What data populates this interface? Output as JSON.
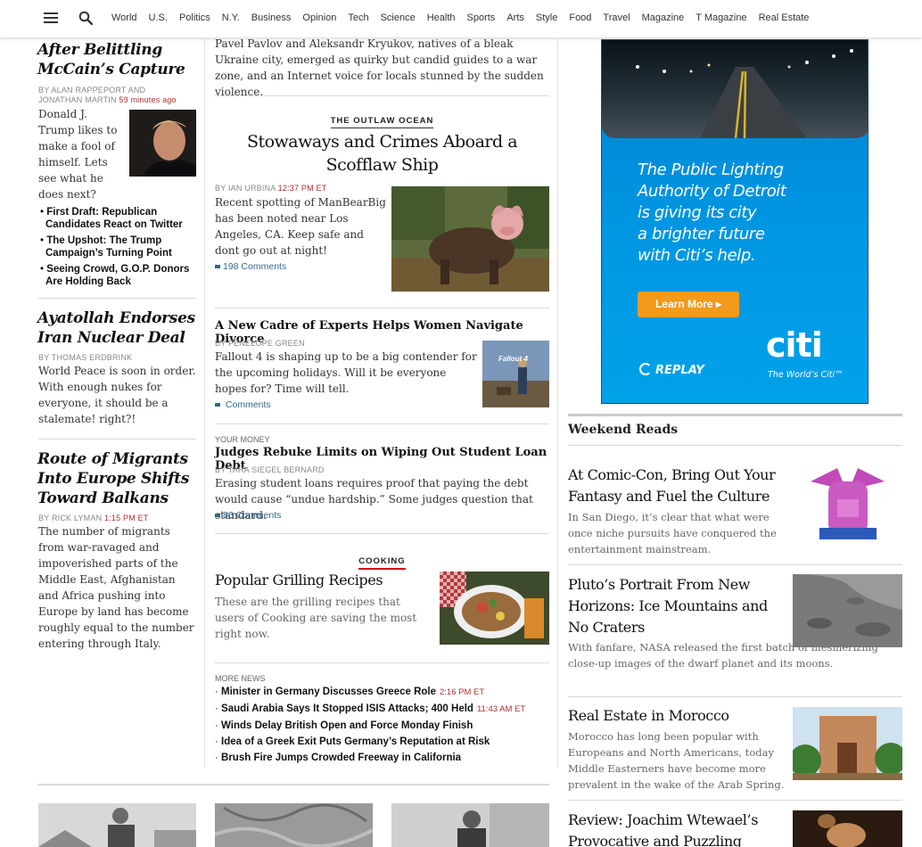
{
  "nav": {
    "items": [
      "World",
      "U.S.",
      "Politics",
      "N.Y.",
      "Business",
      "Opinion",
      "Tech",
      "Science",
      "Health",
      "Sports",
      "Arts",
      "Style",
      "Food",
      "Travel",
      "Magazine",
      "T Magazine",
      "Real Estate"
    ]
  },
  "left": {
    "story1": {
      "headline": "After Belittling McCain’s Capture",
      "byline_a": "By ALAN RAPPEPORT and",
      "byline_b": "JONATHAN MARTIN",
      "time": "59 minutes ago",
      "summary": "Donald J. Trump likes to make a fool of himself. Lets see what he does next?",
      "related": [
        "First Draft: Republican Candidates React on Twitter",
        "The Upshot: The Trump Campaign’s Turning Point",
        "Seeing Crowd, G.O.P. Donors Are Holding Back"
      ]
    },
    "story2": {
      "headline": "Ayatollah Endorses Iran Nuclear Deal",
      "byline": "By THOMAS ERDBRINK",
      "summary": "World Peace is soon in order. With enough nukes for everyone, it should be a stalemate! right?!"
    },
    "story3": {
      "headline": "Route of Migrants Into Europe Shifts Toward Balkans",
      "byline": "By RICK LYMAN",
      "time": "1:15 PM ET",
      "summary": "The number of migrants from war-ravaged and impoverished parts of the Middle East, Afghanistan and Africa pushing into Europe by land has become roughly equal to the number entering through Italy."
    }
  },
  "middle": {
    "top_summary": "Pavel Pavlov and Aleksandr Kryukov, natives of a bleak Ukraine city, emerged as quirky but candid guides to a war zone, and an Internet voice for locals stunned by the sudden violence.",
    "outlaw": {
      "kicker": "THE OUTLAW OCEAN",
      "headline": "Stowaways and Crimes Aboard a Scofflaw Ship",
      "byline": "By IAN URBINA",
      "time": "12:37 PM ET",
      "summary": "Recent spotting of ManBearBig has been noted near Los Angeles, CA. Keep safe and dont go out at night!",
      "comments": "198 Comments"
    },
    "divorce": {
      "headline": "A New Cadre of Experts Helps Women Navigate Divorce",
      "byline": "By PENELOPE GREEN",
      "summary": "Fallout 4 is shaping up to be a big contender for the upcoming holidays. Will it be everyone hopes for? Time will tell.",
      "comments": "Comments",
      "thumb_text": "Fallout 4"
    },
    "loans": {
      "section": "YOUR MONEY",
      "headline": "Judges Rebuke Limits on Wiping Out Student Loan Debt",
      "byline": "By TARA SIEGEL BERNARD",
      "summary": "Erasing student loans requires proof that paying the debt would cause “undue hardship.” Some judges question that standard.",
      "comments": "86 Comments"
    },
    "cooking": {
      "kicker": "COOKING",
      "headline": "Popular Grilling Recipes",
      "summary": "These are the grilling recipes that users of Cooking are saving the most right now."
    },
    "more_news": {
      "label": "MORE NEWS",
      "items": [
        {
          "text": "Minister in Germany Discusses Greece Role",
          "time": "2:16 PM ET"
        },
        {
          "text": "Saudi Arabia Says It Stopped ISIS Attacks; 400 Held",
          "time": "11:43 AM ET"
        },
        {
          "text": "Winds Delay British Open and Force Monday Finish",
          "time": ""
        },
        {
          "text": "Idea of a Greek Exit Puts Germany’s Reputation at Risk",
          "time": ""
        },
        {
          "text": "Brush Fire Jumps Crowded Freeway in California",
          "time": ""
        }
      ]
    }
  },
  "ad": {
    "line1": "The Public Lighting",
    "line2": "Authority of Detroit",
    "line3": "is giving its city",
    "line4": "a brighter future",
    "line5": "with Citi’s help.",
    "button": "Learn More ▸",
    "replay": "REPLAY",
    "brand": "citi",
    "tagline": "The World’s Citi™"
  },
  "right": {
    "section_title": "Weekend Reads",
    "items": [
      {
        "title": "At Comic-Con, Bring Out Your Fantasy and Fuel the Culture",
        "summary": "In San Diego, it’s clear that what were once niche pursuits have conquered the entertainment mainstream."
      },
      {
        "title": "Pluto’s Portrait From New Horizons: Ice Mountains and No Craters",
        "summary": "With fanfare, NASA released the first batch of mesmerizing close-up images of the dwarf planet and its moons."
      },
      {
        "title": "Real Estate in Morocco",
        "summary": "Morocco has long been popular with Europeans and North Americans, today Middle Easterners have become more prevalent in the wake of the Arab Spring."
      },
      {
        "title": "Review: Joachim Wtewael’s Provocative and Puzzling",
        "summary": ""
      }
    ]
  },
  "colors": {
    "link_blue": "#326891",
    "time_red": "#b03030",
    "cooking_red": "#d0021b",
    "ad_blue": "#0094e0",
    "ad_button": "#f39a1c"
  }
}
